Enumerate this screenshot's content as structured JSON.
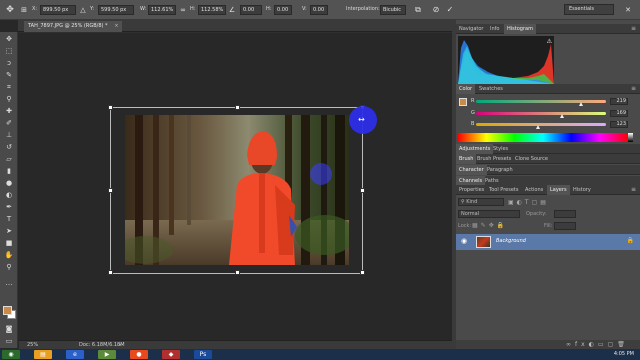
{
  "options_bar": {
    "x_label": "X:",
    "x_value": "899.50 px",
    "y_label": "Y:",
    "y_value": "599.50 px",
    "w_label": "W:",
    "w_value": "112.61%",
    "h_label": "H:",
    "h_value": "112.58%",
    "angle_value": "0.00",
    "h_skew_label": "H:",
    "h_skew_value": "0.00",
    "v_skew_label": "V:",
    "v_skew_value": "0.00",
    "interpolation_label": "Interpolation:",
    "interpolation_value": "Bicubic",
    "workspace": "Essentials"
  },
  "document_tab": {
    "title": "TAH_7897.JPG @ 25% (RGB/8) *",
    "close": "×"
  },
  "status_bar": {
    "zoom": "25%",
    "doc_info": "Doc: 6.18M/6.18M"
  },
  "panels": {
    "group1_tabs": [
      "Navigator",
      "Info",
      "Histogram"
    ],
    "active_group1": "Histogram",
    "group2_tabs": [
      "Color",
      "Swatches"
    ],
    "color_channels": [
      {
        "label": "R",
        "value": "219"
      },
      {
        "label": "G",
        "value": "169"
      },
      {
        "label": "B",
        "value": "123"
      }
    ],
    "group3_tabs": [
      "Adjustments",
      "Styles"
    ],
    "group4_tabs": [
      "Brush",
      "Brush Presets",
      "Clone Source"
    ],
    "group5_tabs": [
      "Character",
      "Paragraph"
    ],
    "group6_tabs": [
      "Channels",
      "Paths"
    ],
    "group7_tabs": [
      "Properties",
      "Tool Presets",
      "Actions",
      "Layers",
      "History"
    ],
    "active_group7": "Layers",
    "layers": {
      "kind_filter": "Kind",
      "blend_mode": "Normal",
      "opacity_label": "Opacity:",
      "lock_label": "Lock:",
      "fill_label": "Fill:",
      "layer_name": "Background"
    }
  },
  "taskbar": {
    "time": "4:05 PM"
  },
  "colors": {
    "foreground": "#c98a4a",
    "background": "#ffffff",
    "selected_layer": "#5a78a8"
  }
}
